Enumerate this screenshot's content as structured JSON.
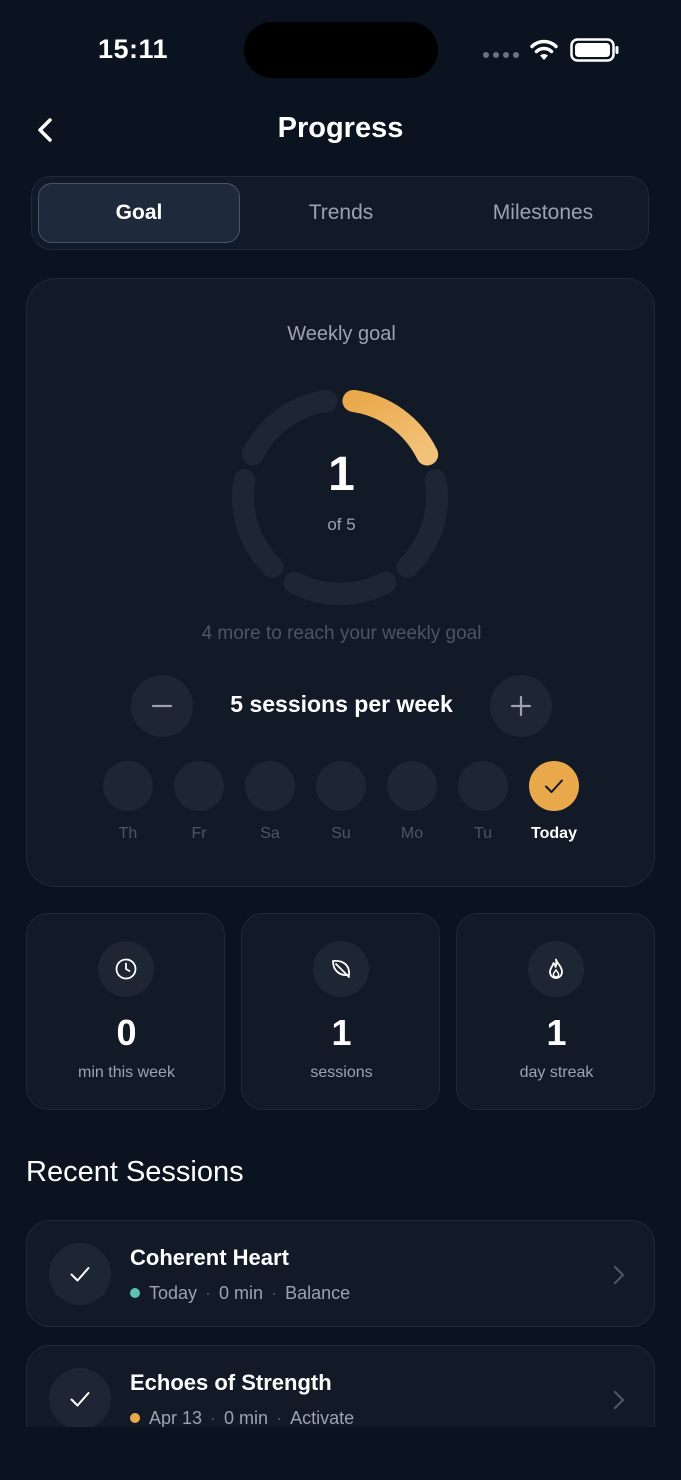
{
  "status": {
    "time": "15:11"
  },
  "nav": {
    "title": "Progress"
  },
  "tabs": [
    {
      "label": "Goal",
      "active": true
    },
    {
      "label": "Trends",
      "active": false
    },
    {
      "label": "Milestones",
      "active": false
    }
  ],
  "goal": {
    "label": "Weekly goal",
    "count": "1",
    "of_text": "of 5",
    "progress": 0.2,
    "hint": "4 more to reach your weekly goal",
    "value_text": "5 sessions per week",
    "accent": "#e9a94b",
    "days": [
      {
        "label": "Th",
        "done": false
      },
      {
        "label": "Fr",
        "done": false
      },
      {
        "label": "Sa",
        "done": false
      },
      {
        "label": "Su",
        "done": false
      },
      {
        "label": "Mo",
        "done": false
      },
      {
        "label": "Tu",
        "done": false
      },
      {
        "label": "Today",
        "done": true
      }
    ]
  },
  "stats": [
    {
      "icon": "clock-icon",
      "value": "0",
      "label": "min this week"
    },
    {
      "icon": "leaf-icon",
      "value": "1",
      "label": "sessions"
    },
    {
      "icon": "flame-icon",
      "value": "1",
      "label": "day streak"
    }
  ],
  "recent": {
    "title": "Recent Sessions",
    "items": [
      {
        "title": "Coherent Heart",
        "date": "Today",
        "duration": "0 min",
        "category": "Balance",
        "dot_color": "#5ec4b0"
      },
      {
        "title": "Echoes of Strength",
        "date": "Apr 13",
        "duration": "0 min",
        "category": "Activate",
        "dot_color": "#e9a94b"
      }
    ]
  }
}
